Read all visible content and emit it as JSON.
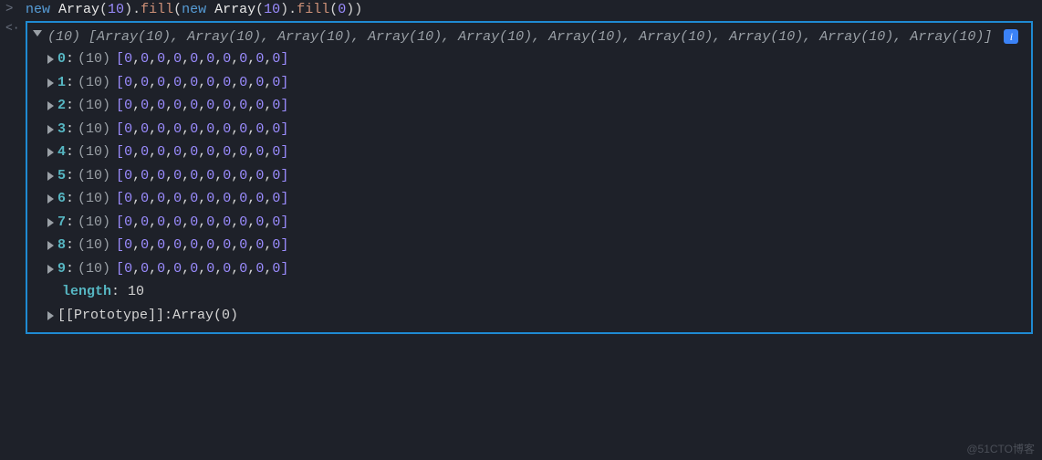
{
  "input": {
    "tokens": [
      {
        "t": "new ",
        "cls": "kw-new"
      },
      {
        "t": "Array",
        "cls": "clsname"
      },
      {
        "t": "(",
        "cls": "paren"
      },
      {
        "t": "10",
        "cls": "num"
      },
      {
        "t": ").",
        "cls": "paren"
      },
      {
        "t": "fill",
        "cls": "fn"
      },
      {
        "t": "(",
        "cls": "paren"
      },
      {
        "t": "new ",
        "cls": "kw-new"
      },
      {
        "t": "Array",
        "cls": "clsname"
      },
      {
        "t": "(",
        "cls": "paren"
      },
      {
        "t": "10",
        "cls": "num"
      },
      {
        "t": ").",
        "cls": "paren"
      },
      {
        "t": "fill",
        "cls": "fn"
      },
      {
        "t": "(",
        "cls": "paren"
      },
      {
        "t": "0",
        "cls": "num"
      },
      {
        "t": "))",
        "cls": "paren"
      }
    ]
  },
  "result": {
    "summary_count": "(10)",
    "summary_items": [
      "Array(10)",
      "Array(10)",
      "Array(10)",
      "Array(10)",
      "Array(10)",
      "Array(10)",
      "Array(10)",
      "Array(10)",
      "Array(10)",
      "Array(10)"
    ],
    "rows": [
      {
        "index": "0",
        "count": "(10)",
        "values": [
          "0",
          "0",
          "0",
          "0",
          "0",
          "0",
          "0",
          "0",
          "0",
          "0"
        ]
      },
      {
        "index": "1",
        "count": "(10)",
        "values": [
          "0",
          "0",
          "0",
          "0",
          "0",
          "0",
          "0",
          "0",
          "0",
          "0"
        ]
      },
      {
        "index": "2",
        "count": "(10)",
        "values": [
          "0",
          "0",
          "0",
          "0",
          "0",
          "0",
          "0",
          "0",
          "0",
          "0"
        ]
      },
      {
        "index": "3",
        "count": "(10)",
        "values": [
          "0",
          "0",
          "0",
          "0",
          "0",
          "0",
          "0",
          "0",
          "0",
          "0"
        ]
      },
      {
        "index": "4",
        "count": "(10)",
        "values": [
          "0",
          "0",
          "0",
          "0",
          "0",
          "0",
          "0",
          "0",
          "0",
          "0"
        ]
      },
      {
        "index": "5",
        "count": "(10)",
        "values": [
          "0",
          "0",
          "0",
          "0",
          "0",
          "0",
          "0",
          "0",
          "0",
          "0"
        ]
      },
      {
        "index": "6",
        "count": "(10)",
        "values": [
          "0",
          "0",
          "0",
          "0",
          "0",
          "0",
          "0",
          "0",
          "0",
          "0"
        ]
      },
      {
        "index": "7",
        "count": "(10)",
        "values": [
          "0",
          "0",
          "0",
          "0",
          "0",
          "0",
          "0",
          "0",
          "0",
          "0"
        ]
      },
      {
        "index": "8",
        "count": "(10)",
        "values": [
          "0",
          "0",
          "0",
          "0",
          "0",
          "0",
          "0",
          "0",
          "0",
          "0"
        ]
      },
      {
        "index": "9",
        "count": "(10)",
        "values": [
          "0",
          "0",
          "0",
          "0",
          "0",
          "0",
          "0",
          "0",
          "0",
          "0"
        ]
      }
    ],
    "length_key": "length",
    "length_val": "10",
    "prototype_key": "[[Prototype]]",
    "prototype_val": "Array(0)"
  },
  "prompts": {
    "input": ">",
    "output": "<·"
  },
  "info_glyph": "i",
  "watermark": "@51CTO博客"
}
